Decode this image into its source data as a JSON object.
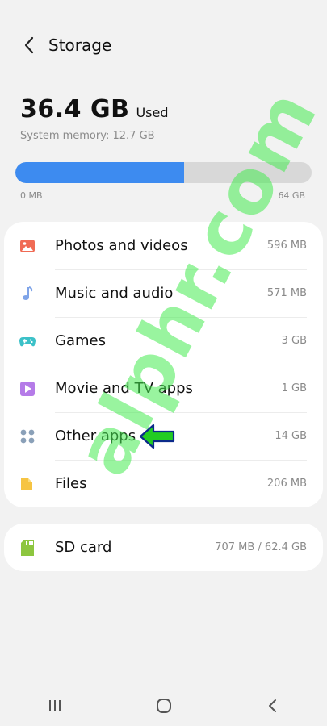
{
  "header": {
    "title": "Storage"
  },
  "usage": {
    "used_value": "36.4 GB",
    "used_suffix": "Used",
    "system_memory": "System memory: 12.7 GB",
    "bar_fill_fraction": 0.57,
    "min_label": "0 MB",
    "max_label": "64 GB"
  },
  "categories": [
    {
      "label": "Photos and videos",
      "size": "596 MB",
      "icon": "photos-icon",
      "color": "#f06b55"
    },
    {
      "label": "Music and audio",
      "size": "571 MB",
      "icon": "music-note-icon",
      "color": "#7fa4e8"
    },
    {
      "label": "Games",
      "size": "3 GB",
      "icon": "gamepad-icon",
      "color": "#3cc1c8"
    },
    {
      "label": "Movie and TV apps",
      "size": "1 GB",
      "icon": "play-icon",
      "color": "#b57be8"
    },
    {
      "label": "Other apps",
      "size": "14 GB",
      "icon": "apps-grid-icon",
      "color": "#8aa0b8"
    },
    {
      "label": "Files",
      "size": "206 MB",
      "icon": "folder-icon",
      "color": "#f6c443"
    }
  ],
  "sd_card": {
    "label": "SD card",
    "size": "707 MB / 62.4 GB",
    "icon": "sd-card-icon",
    "color": "#8dc63f"
  },
  "watermark": "alphr.com",
  "colors": {
    "bar_fill": "#3d8bf0",
    "bar_track": "#d8d8d8",
    "arrow": "#22cc22"
  }
}
